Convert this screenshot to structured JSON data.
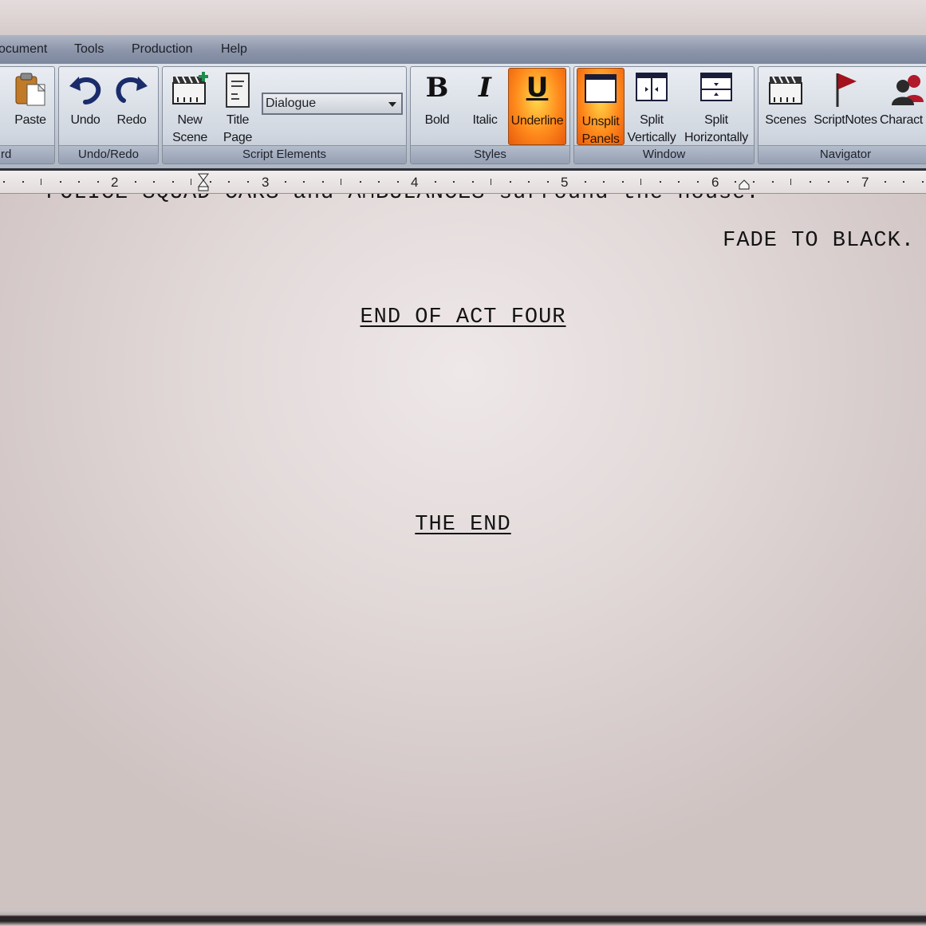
{
  "menu": [
    "ocument",
    "Tools",
    "Production",
    "Help"
  ],
  "ribbon": {
    "clipboard": {
      "paste": "Paste",
      "group_label": "rd"
    },
    "undo_redo": {
      "undo": "Undo",
      "redo": "Redo",
      "group_label": "Undo/Redo"
    },
    "script_elements": {
      "new_scene": [
        "New",
        "Scene"
      ],
      "title_page": [
        "Title",
        "Page"
      ],
      "element_select": "Dialogue",
      "group_label": "Script Elements"
    },
    "styles": {
      "bold": "Bold",
      "italic": "Italic",
      "underline": "Underline",
      "group_label": "Styles",
      "glyph_bold": "B",
      "glyph_italic": "I",
      "glyph_underline": "U"
    },
    "window": {
      "unsplit": [
        "Unsplit",
        "Panels"
      ],
      "split_v": [
        "Split",
        "Vertically"
      ],
      "split_h": [
        "Split",
        "Horizontally"
      ],
      "group_label": "Window"
    },
    "navigator": {
      "scenes": "Scenes",
      "scriptnotes": "ScriptNotes",
      "characters": "Charact",
      "group_label": "Navigator"
    }
  },
  "ruler": [
    "2",
    "3",
    "4",
    "5",
    "6",
    "7"
  ],
  "script": {
    "cut_line": "POLICE SQUAD CARS and AMBULANCES surround the house.",
    "transition": "FADE TO BLACK.",
    "act_end": "END OF ACT FOUR",
    "the_end": "THE END"
  },
  "colors": {
    "active_button": "#ff8a1c",
    "menubar": "#8c95aa"
  }
}
